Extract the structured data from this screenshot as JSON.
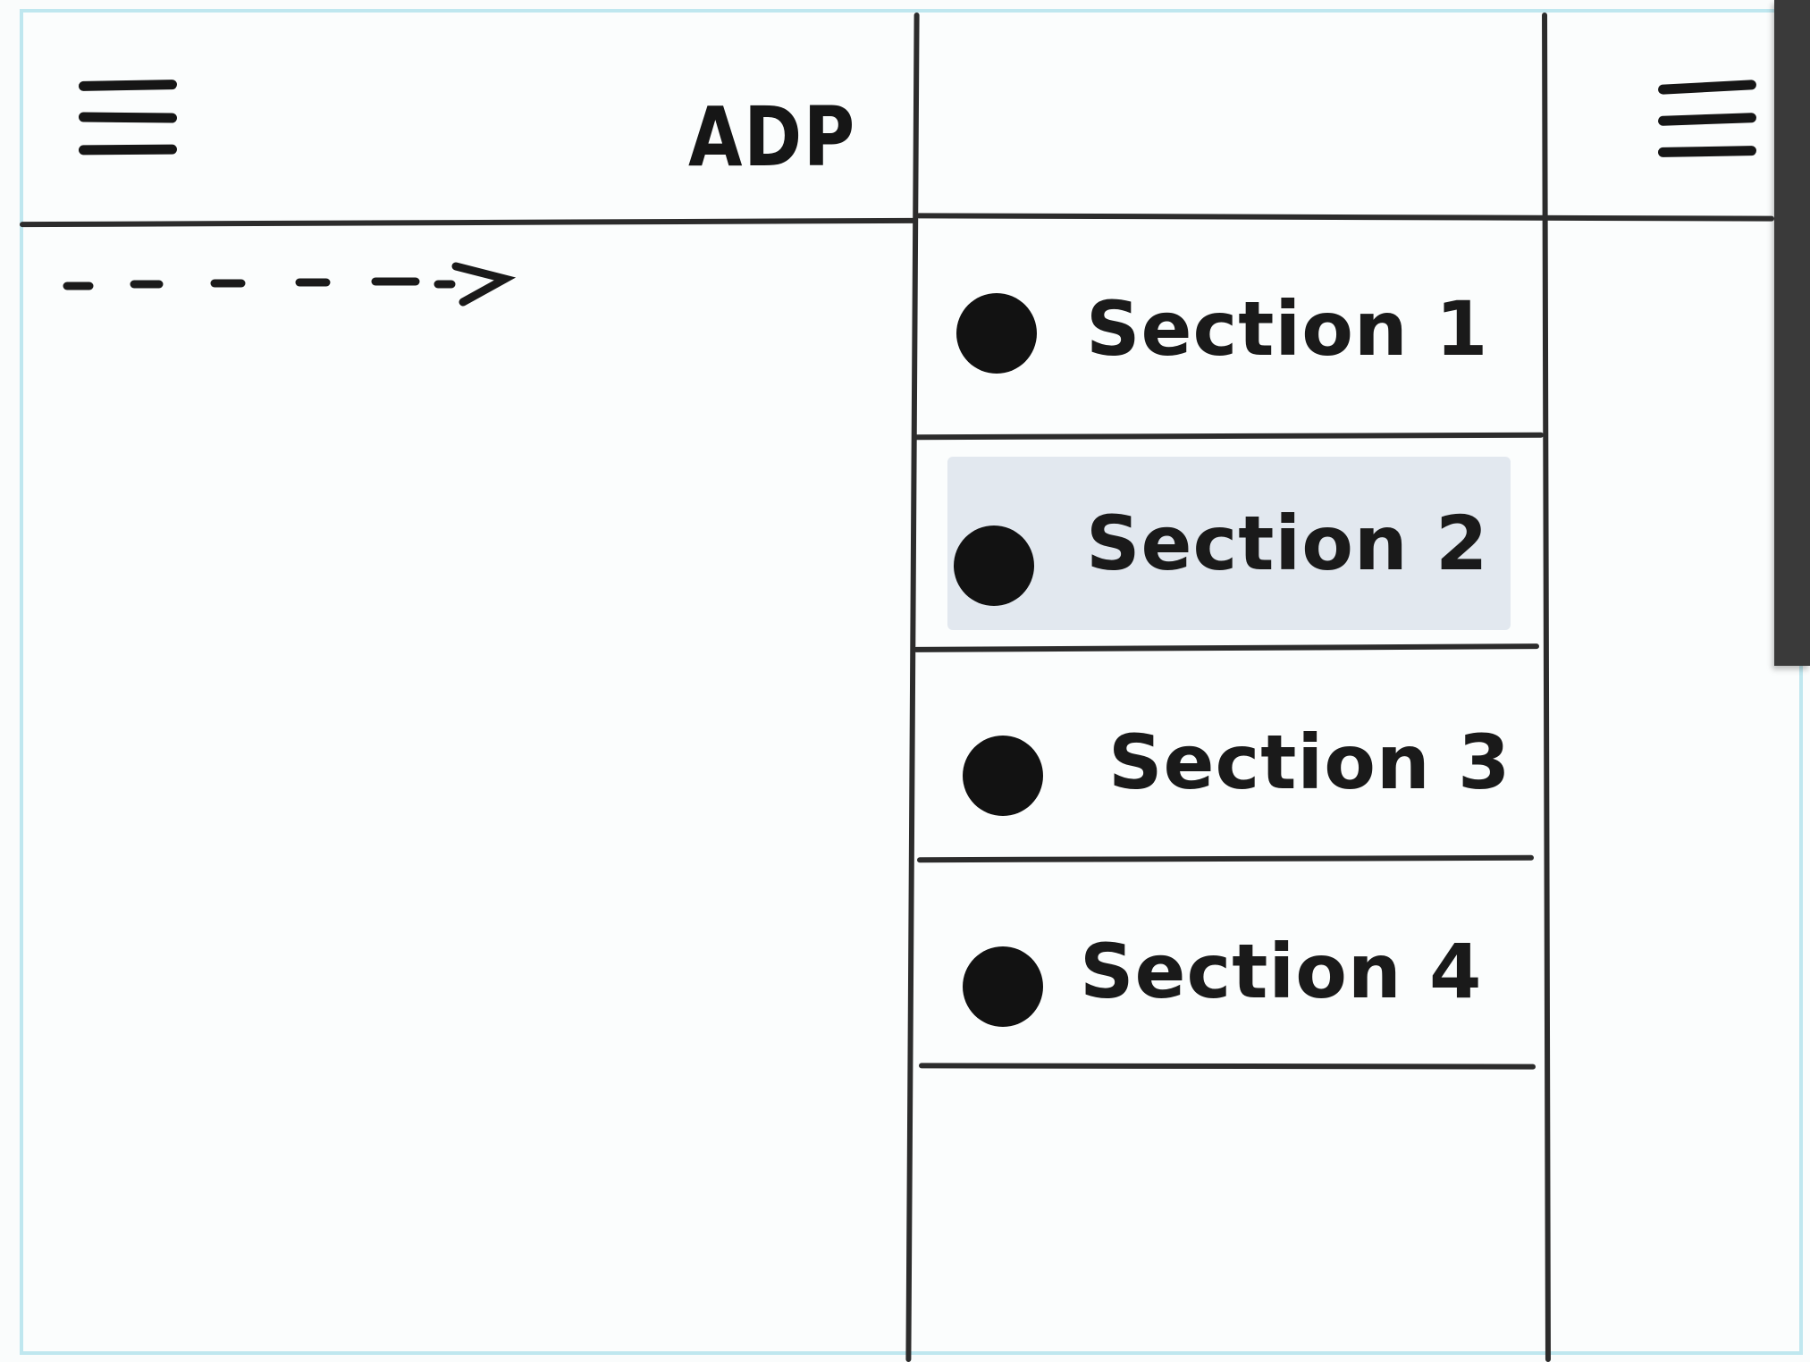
{
  "header": {
    "title": "ADP",
    "left_menu_icon": "hamburger-icon",
    "right_menu_icon": "hamburger-icon"
  },
  "gesture": {
    "icon": "dashed-arrow-right-icon"
  },
  "drawer": {
    "items": [
      {
        "label": "Section 1",
        "icon": "bullet-icon",
        "selected": false
      },
      {
        "label": "Section 2",
        "icon": "bullet-icon",
        "selected": true
      },
      {
        "label": "Section 3",
        "icon": "bullet-icon",
        "selected": false
      },
      {
        "label": "Section 4",
        "icon": "bullet-icon",
        "selected": false
      }
    ],
    "selected_color": "#e2e8ef"
  },
  "colors": {
    "ink": "#161616",
    "frame": "#bfe7ef",
    "paper": "#fbfdfd"
  }
}
